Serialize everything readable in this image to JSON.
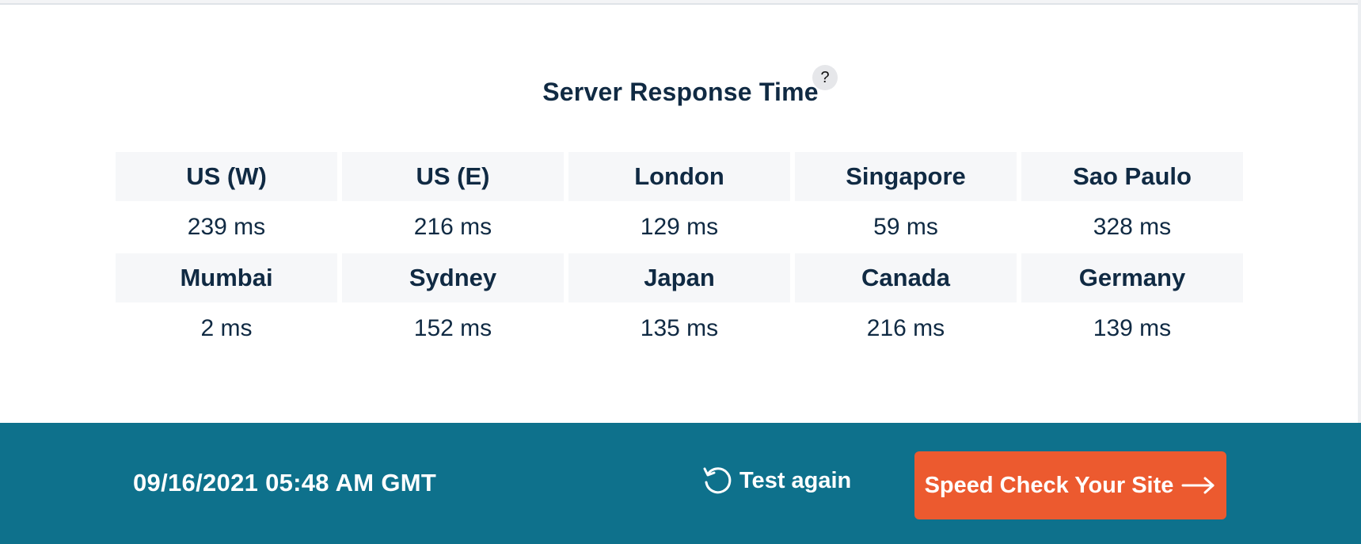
{
  "section": {
    "title": "Server Response Time",
    "help_label": "?"
  },
  "locations_row1": [
    {
      "name": "US (W)",
      "time": "239 ms"
    },
    {
      "name": "US (E)",
      "time": "216 ms"
    },
    {
      "name": "London",
      "time": "129 ms"
    },
    {
      "name": "Singapore",
      "time": "59 ms"
    },
    {
      "name": "Sao Paulo",
      "time": "328 ms"
    }
  ],
  "locations_row2": [
    {
      "name": "Mumbai",
      "time": "2 ms"
    },
    {
      "name": "Sydney",
      "time": "152 ms"
    },
    {
      "name": "Japan",
      "time": "135 ms"
    },
    {
      "name": "Canada",
      "time": "216 ms"
    },
    {
      "name": "Germany",
      "time": "139 ms"
    }
  ],
  "footer": {
    "timestamp": "09/16/2021 05:48 AM GMT",
    "test_again_label": "Test again",
    "test_again_icon": "refresh-icon",
    "cta_label": "Speed Check Your Site",
    "cta_icon": "arrow-right-icon",
    "background_color": "#0e718c",
    "cta_color": "#ec5a2f"
  }
}
